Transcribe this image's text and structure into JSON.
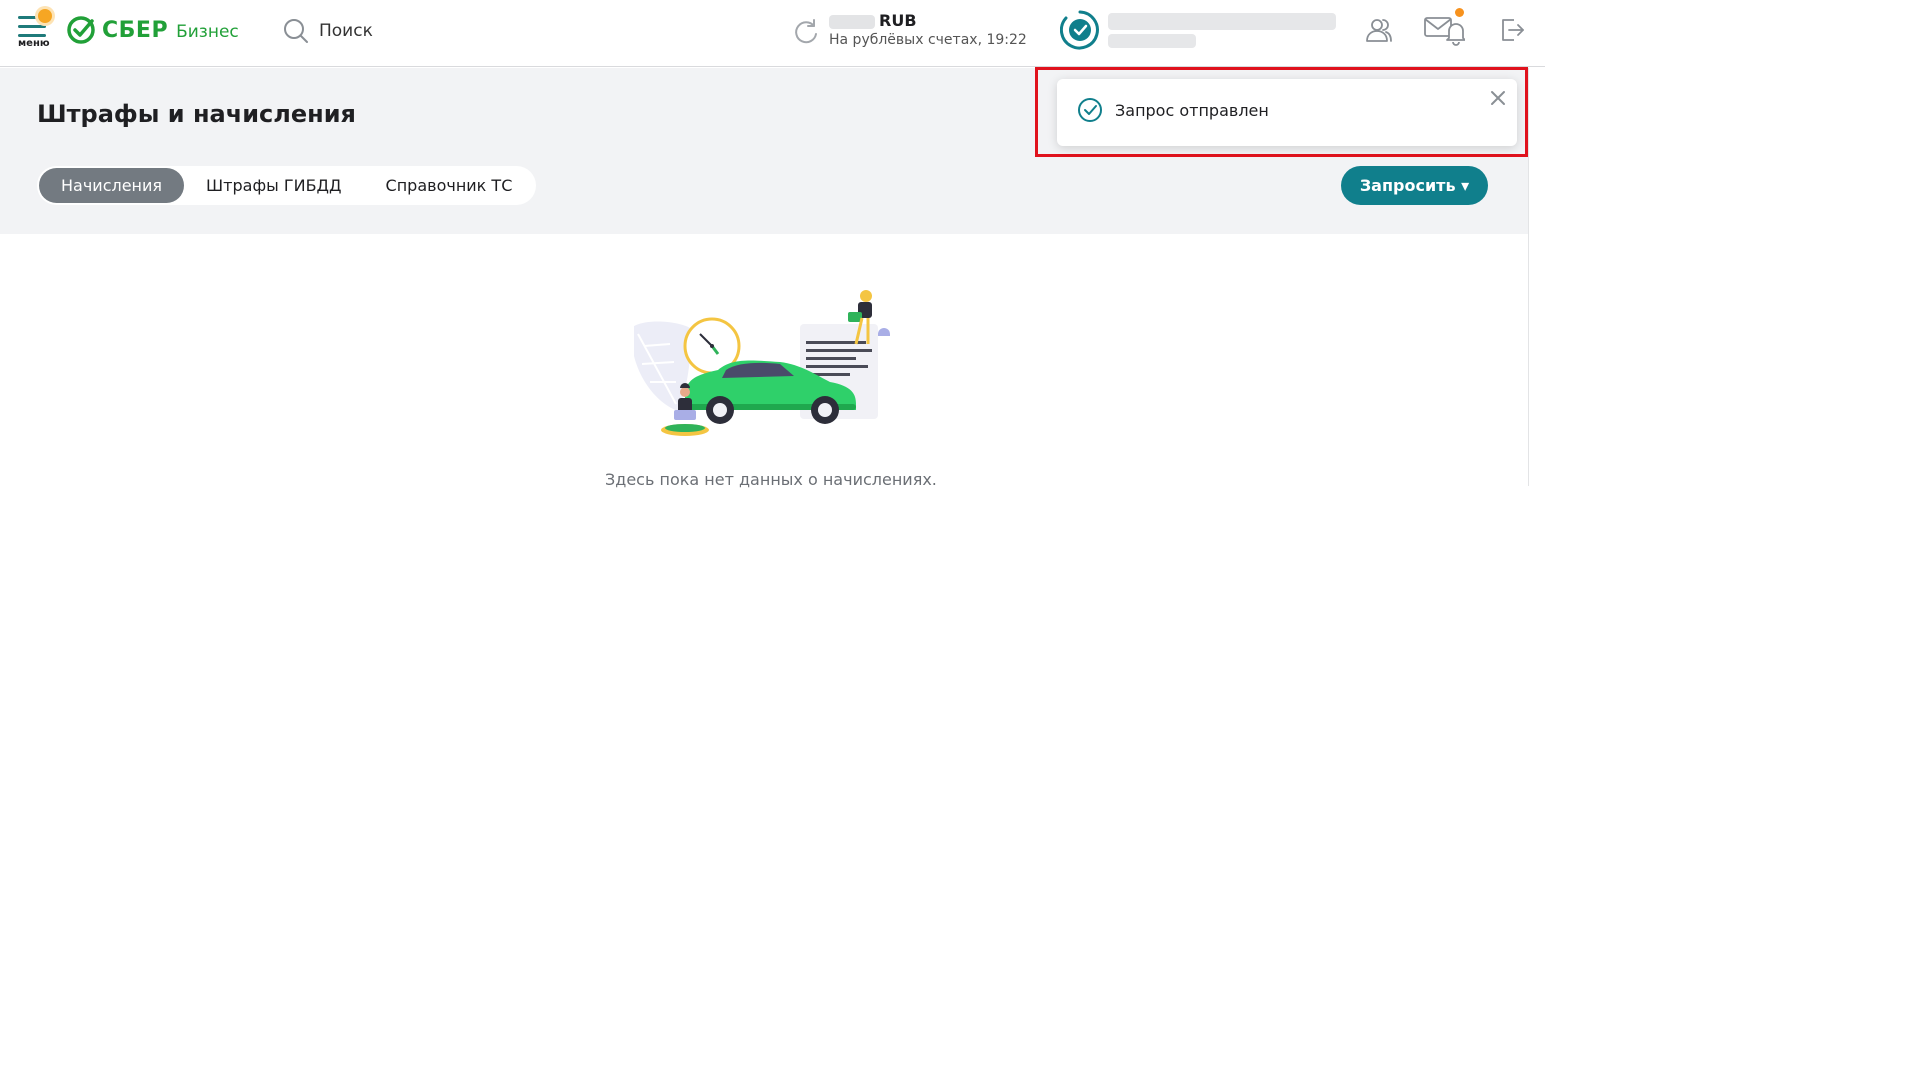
{
  "header": {
    "menu_label": "меню",
    "logo_text": "СБЕР",
    "logo_sub": "Бизнес",
    "search_label": "Поиск",
    "balance_currency": "RUB",
    "balance_subtitle": "На рублёвых счетах, 19:22"
  },
  "page": {
    "title": "Штрафы и начисления",
    "tabs": [
      {
        "label": "Начисления",
        "active": true
      },
      {
        "label": "Штрафы ГИБДД",
        "active": false
      },
      {
        "label": "Справочник ТС",
        "active": false
      }
    ],
    "request_button": "Запросить ▾",
    "empty_text": "Здесь пока нет данных о начислениях."
  },
  "toast": {
    "message": "Запрос отправлен"
  },
  "colors": {
    "brand_green": "#21a038",
    "accent_teal": "#107f8c",
    "tab_active": "#737a81",
    "highlight": "#e0121d",
    "notification": "#f7921e"
  },
  "icons": [
    "menu-icon",
    "sber-logo-icon",
    "search-icon",
    "refresh-icon",
    "org-status-icon",
    "users-icon",
    "mail-bell-icon",
    "logout-icon",
    "check-circle-icon",
    "close-icon"
  ]
}
